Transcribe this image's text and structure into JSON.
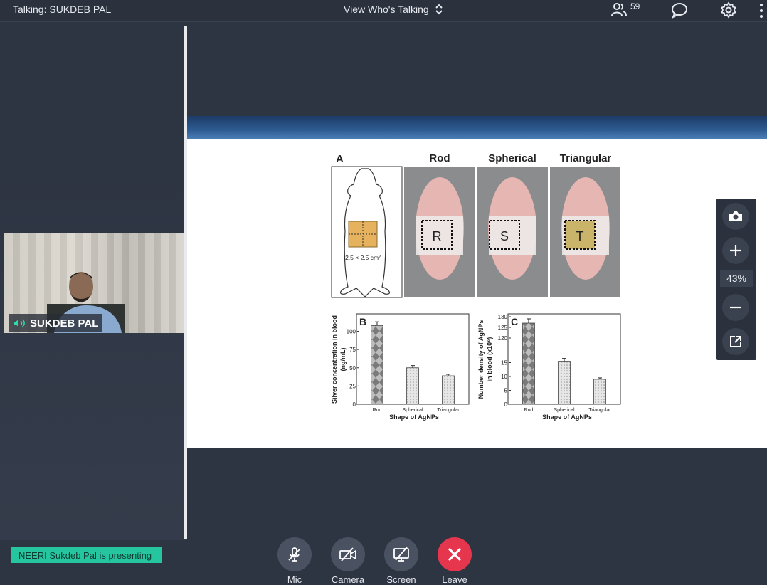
{
  "topbar": {
    "talking": "Talking: SUKDEB PAL",
    "view_label": "View Who's Talking",
    "participant_count": "59"
  },
  "video": {
    "name": "SUKDEB PAL"
  },
  "slide": {
    "panel_a_label": "A",
    "columns": [
      "Rod",
      "Spherical",
      "Triangular"
    ],
    "patch_labels": [
      "R",
      "S",
      "T"
    ],
    "patch_size": "2.5 × 2.5 cm²",
    "chart_b": {
      "label": "B",
      "ylabel_line1": "Silver concentration in blood",
      "ylabel_line2": "(ng/mL)",
      "xlabel": "Shape of AgNPs",
      "yticks": [
        "0",
        "25",
        "50",
        "75",
        "100"
      ]
    },
    "chart_c": {
      "label": "C",
      "ylabel_line1": "Number density of AgNPs",
      "ylabel_line2": "in blood (x10⁸)",
      "xlabel": "Shape of AgNPs",
      "yticks": [
        "0",
        "5",
        "10",
        "15",
        "120",
        "125",
        "130"
      ]
    }
  },
  "chart_data": [
    {
      "type": "bar",
      "categories": [
        "Rod",
        "Spherical",
        "Triangular"
      ],
      "values": [
        108,
        50,
        39
      ],
      "error": [
        5,
        3,
        2
      ],
      "xlabel": "Shape of AgNPs",
      "ylabel": "Silver concentration in blood (ng/mL)",
      "ylim": [
        0,
        120
      ]
    },
    {
      "type": "bar",
      "categories": [
        "Rod",
        "Spherical",
        "Triangular"
      ],
      "values": [
        127,
        15.5,
        9
      ],
      "error": [
        2,
        1,
        0.5
      ],
      "xlabel": "Shape of AgNPs",
      "ylabel": "Number density of AgNPs in blood (x10⁸)",
      "ylim": [
        0,
        130
      ]
    }
  ],
  "zoom": {
    "level": "43%"
  },
  "presenting": "NEERI Sukdeb Pal is presenting",
  "controls": {
    "mic": "Mic",
    "camera": "Camera",
    "screen": "Screen",
    "leave": "Leave"
  }
}
